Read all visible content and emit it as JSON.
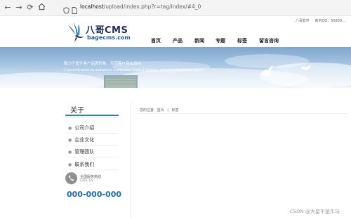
{
  "browser": {
    "back_icon": "arrow-left-icon",
    "forward_icon": "arrow-right-icon",
    "reload_icon": "reload-icon",
    "home_icon": "home-icon",
    "address_host": "localhost",
    "address_path": "/upload/index.php?r=tag/index/#4_0"
  },
  "header": {
    "top_links": [
      "八哥软件",
      "商务QQ：",
      "55659..."
    ],
    "logo_title": "八哥CMS",
    "logo_subtitle": "bagecms.com",
    "nav": [
      "首页",
      "产品",
      "新闻",
      "专题",
      "标签",
      "留言咨询"
    ]
  },
  "banner": {
    "line1": "致力于提升客户品牌形象，实现客户商业目标",
    "line2": "Commitment to enhance customer brand image, achieve business goals"
  },
  "sidebar": {
    "title": "关于",
    "items": [
      "公司介绍",
      "企业文化",
      "管理团队",
      "联系我们"
    ],
    "service_label": "全国服务热线",
    "service_sub": "CALL US",
    "hotline": "000-000-000"
  },
  "content": {
    "breadcrumb": [
      "您的位置",
      "首页",
      "标签"
    ]
  },
  "watermark": "CSDN @大星不是牛马",
  "colors": {
    "accent": "#2a7fd0",
    "hotline": "#1c6fb3",
    "logo_dark": "#1c2f52"
  }
}
